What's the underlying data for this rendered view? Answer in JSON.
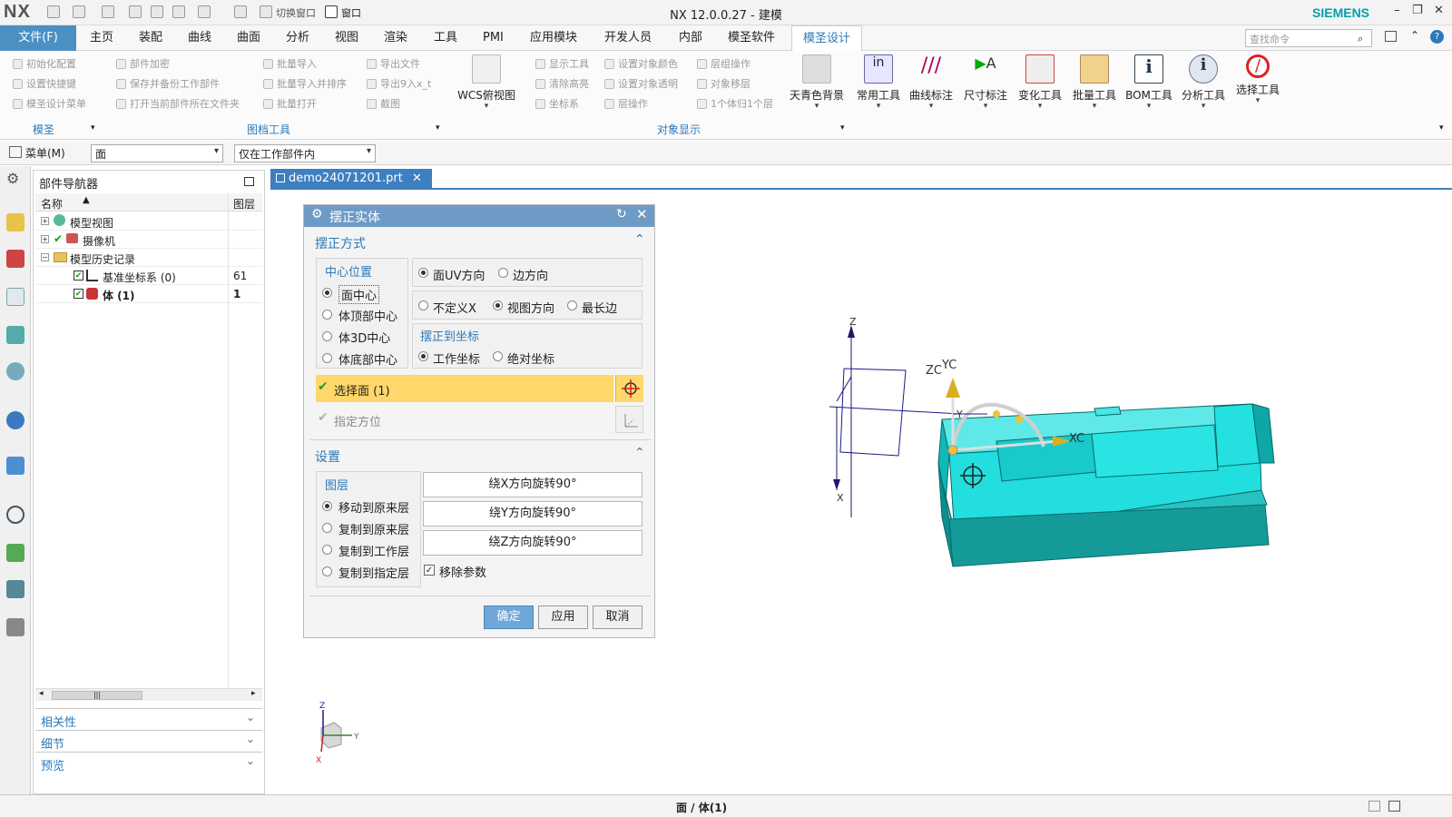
{
  "app": {
    "logo": "NX",
    "window_title": "NX 12.0.0.27 - 建模",
    "brand": "SIEMENS",
    "switch_window": "切换窗口",
    "window_menu": "窗口"
  },
  "menu": {
    "file": "文件(F)",
    "tabs": [
      "主页",
      "装配",
      "曲线",
      "曲面",
      "分析",
      "视图",
      "渲染",
      "工具",
      "PMI",
      "应用模块",
      "开发人员",
      "内部",
      "模圣软件",
      "模圣设计"
    ],
    "active_tab": "模圣设计",
    "search_placeholder": "查找命令"
  },
  "ribbon": {
    "group1": {
      "items": [
        "初始化配置",
        "设置快捷键",
        "模圣设计菜单"
      ],
      "label": "模圣"
    },
    "group2": {
      "col1": [
        "部件加密",
        "保存并备份工作部件",
        "打开当前部件所在文件夹"
      ],
      "col2": [
        "批量导入",
        "批量导入并排序",
        "批量打开"
      ],
      "col3": [
        "导出文件",
        "导出9入x_t",
        "截图"
      ],
      "label": "图档工具"
    },
    "wcs": "WCS俯视图",
    "group3": {
      "col1": [
        "显示工具",
        "清除高亮",
        "坐标系"
      ],
      "col2": [
        "设置对象颜色",
        "设置对象透明",
        "层操作"
      ],
      "col3": [
        "层组操作",
        "对象移层",
        "1个体归1个层"
      ],
      "label": "对象显示"
    },
    "big_tools": [
      "天青色背景",
      "常用工具",
      "曲线标注",
      "尺寸标注",
      "变化工具",
      "批量工具",
      "BOM工具",
      "分析工具",
      "选择工具"
    ]
  },
  "toolbar2": {
    "menu_label": "菜单(M)",
    "filter": "面",
    "scope": "仅在工作部件内"
  },
  "navigator": {
    "title": "部件导航器",
    "col_name": "名称",
    "col_layer": "图层",
    "rows": [
      {
        "label": "模型视图",
        "layer": ""
      },
      {
        "label": "摄像机",
        "layer": ""
      },
      {
        "label": "模型历史记录",
        "layer": ""
      },
      {
        "label": "基准坐标系 (0)",
        "layer": "61"
      },
      {
        "label": "体 (1)",
        "layer": "1"
      }
    ],
    "panels": [
      "相关性",
      "细节",
      "预览"
    ]
  },
  "doc_tab": "demo24071201.prt",
  "dialog": {
    "title": "摆正实体",
    "section1": "摆正方式",
    "center_label": "中心位置",
    "center_options": [
      "面中心",
      "体顶部中心",
      "体3D中心",
      "体底部中心"
    ],
    "center_selected": "面中心",
    "dir_options": [
      "面UV方向",
      "边方向"
    ],
    "dir_selected": "面UV方向",
    "x_options": [
      "不定义X",
      "视图方向",
      "最长边"
    ],
    "x_selected": "视图方向",
    "coord_label": "摆正到坐标",
    "coord_options": [
      "工作坐标",
      "绝对坐标"
    ],
    "coord_selected": "工作坐标",
    "select_face": "选择面 (1)",
    "specify_orient": "指定方位",
    "section2": "设置",
    "layer_label": "图层",
    "layer_options": [
      "移动到原来层",
      "复制到原来层",
      "复制到工作层",
      "复制到指定层"
    ],
    "layer_selected": "移动到原来层",
    "rot_buttons": [
      "绕X方向旋转90°",
      "绕Y方向旋转90°",
      "绕Z方向旋转90°"
    ],
    "remove_params": "移除参数",
    "remove_params_checked": true,
    "ok": "确定",
    "apply": "应用",
    "cancel": "取消"
  },
  "viewport": {
    "axis_labels": {
      "z": "Z",
      "x": "X",
      "y": "Y",
      "zc": "ZC",
      "yc": "YC",
      "xc": "XC"
    },
    "triad": {
      "z": "Z",
      "y": "Y",
      "x": "X"
    }
  },
  "status": {
    "text": "面 / 体(1)"
  },
  "colors": {
    "accent": "#2b79b8",
    "title_blue": "#6e9ac6",
    "highlight": "#ffd76a",
    "body": "#22e3e3"
  }
}
